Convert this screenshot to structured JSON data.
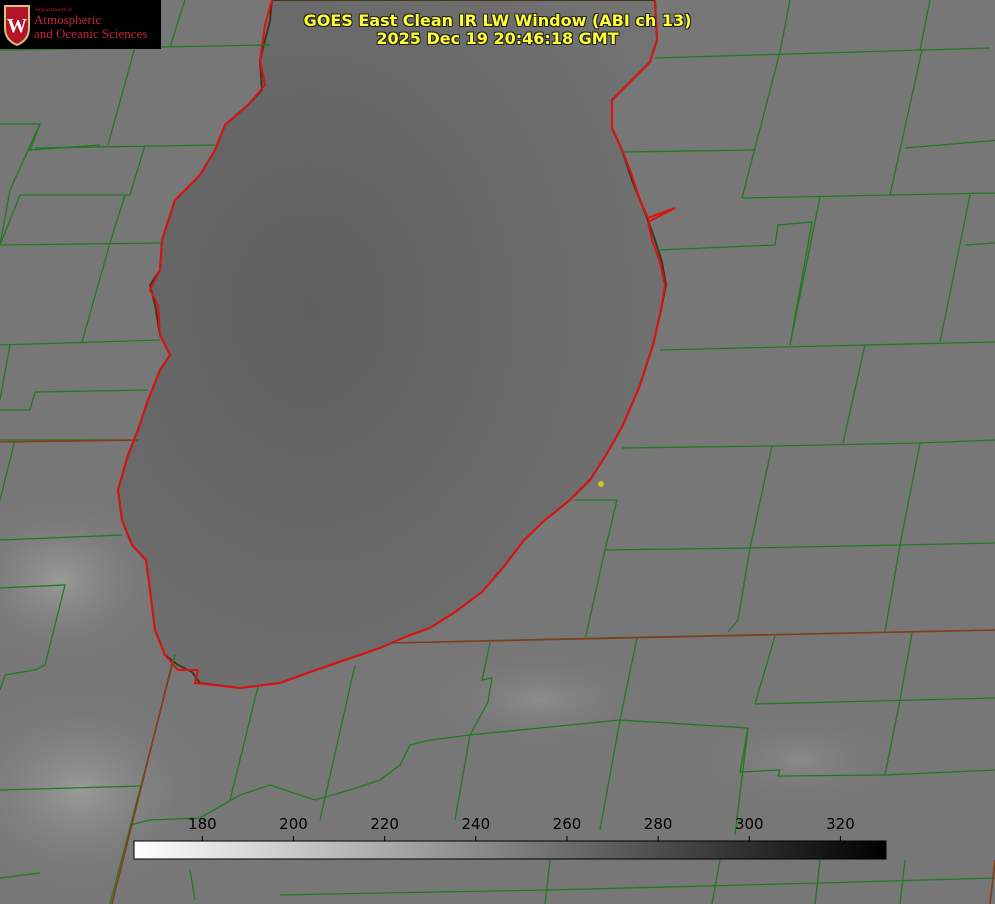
{
  "header": {
    "title": "GOES East Clean IR LW Window (ABI ch 13)",
    "timestamp": "2025 Dec 19 20:46:18 GMT"
  },
  "logo": {
    "department": "Department of",
    "line1": "Atmospheric",
    "line2": "and Oceanic Sciences",
    "seal_letter": "W",
    "color": "#c5283a"
  },
  "colorbar": {
    "units_min": 165,
    "units_max": 330,
    "ticks": [
      "180",
      "200",
      "220",
      "240",
      "260",
      "280",
      "300",
      "320"
    ],
    "gradient_from": "#ffffff",
    "gradient_to": "#000000"
  },
  "overlay_colors": {
    "county_lines": "#1f7a1f",
    "coastline": "#e01010",
    "marker": "#d4c21a",
    "background": "#777777",
    "lake": "#6a6a6a"
  }
}
